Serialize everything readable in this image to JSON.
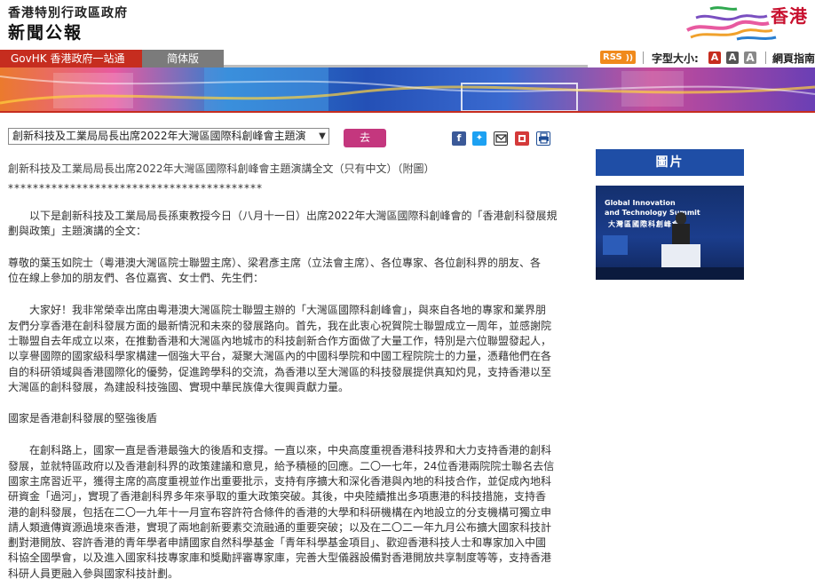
{
  "header": {
    "gov_name": "香港特別行政區政府",
    "site_name": "新聞公報",
    "brand_text": "香港"
  },
  "nav": {
    "govhk_label": "GovHK 香港政府一站通",
    "simplified_label": "简体版",
    "rss_label": "RSS",
    "font_size_label": "字型大小:",
    "font_btn_small": "A",
    "font_btn_medium": "A",
    "font_btn_large": "A",
    "sitemap_label": "網頁指南"
  },
  "selector": {
    "selected": "創新科技及工業局局長出席2022年大灣區國際科創峰會主題演",
    "go_label": "去"
  },
  "share": [
    "facebook-icon",
    "twitter-icon",
    "email-icon",
    "bookmark-icon",
    "print-icon"
  ],
  "sidebar": {
    "photo_heading": "圖片",
    "photo_title_1": "Global Innovation",
    "photo_title_2": "and Technology Summit",
    "photo_title_3": "大灣區國際科創峰會"
  },
  "article": {
    "title": "創新科技及工業局局長出席2022年大灣區國際科創峰會主題演講全文（只有中文）（附圖）",
    "stars": "*****************************************",
    "lines": [
      "　　以下是創新科技及工業局局長孫東教授今日（八月十一日）出席2022年大灣區國際科創峰會的「香港創科發展規",
      "劃與政策」主題演講的全文：",
      "",
      "尊敬的葉玉如院士（粵港澳大灣區院士聯盟主席）、梁君彥主席（立法會主席）、各位專家、各位創科界的朋友、各",
      "位在線上參加的朋友們、各位嘉賓、女士們、先生們：",
      "",
      "　　大家好！我非常榮幸出席由粵港澳大灣區院士聯盟主辦的「大灣區國際科創峰會」，與來自各地的專家和業界朋",
      "友們分享香港在創科發展方面的最新情況和未來的發展路向。首先，我在此衷心祝賀院士聯盟成立一周年，並感謝院",
      "士聯盟自去年成立以來，在推動香港和大灣區內地城市的科技創新合作方面做了大量工作，特別是六位聯盟發起人，",
      "以享譽國際的國家級科學家構建一個強大平台，凝聚大灣區內的中國科學院和中國工程院院士的力量，憑藉他們在各",
      "自的科研領域與香港國際化的優勢，促進跨學科的交流，為香港以至大灣區的科技發展提供真知灼見，支持香港以至",
      "大灣區的創科發展，為建設科技強國、實現中華民族偉大復興貢獻力量。",
      "",
      "國家是香港創科發展的堅強後盾",
      "",
      "　　在創科路上，國家一直是香港最強大的後盾和支撐。一直以來，中央高度重視香港科技界和大力支持香港的創科",
      "發展，並就特區政府以及香港創科界的政策建議和意見，給予積極的回應。二〇一七年，24位香港兩院院士聯名去信",
      "國家主席習近平，獲得主席的高度重視並作出重要批示，支持有序擴大和深化香港與內地的科技合作，並促成內地科",
      "研資金「過河」，實現了香港創科界多年來爭取的重大政策突破。其後，中央陸續推出多項惠港的科技措施，支持香",
      "港的創科發展，包括在二〇一九年十一月宣布容許符合條件的香港的大學和科研機構在內地設立的分支機構可獨立申",
      "請人類遺傳資源過境來香港，實現了兩地創新要素交流融通的重要突破；以及在二〇二一年九月公布擴大國家科技計",
      "劃對港開放、容許香港的青年學者申請國家自然科學基金「青年科學基金項目」、歡迎香港科技人士和專家加入中國",
      "科協全國學會，以及進入國家科技專家庫和獎勵評審專家庫，完善大型儀器設備對香港開放共享制度等等，支持香港",
      "科研人員更融入參與國家科技計劃。"
    ]
  },
  "colors": {
    "accent_red": "#c62d1f",
    "simplified_gray": "#7b7b7b",
    "go_button": "#c4377e",
    "photo_heading": "#1f4ea6",
    "rss_orange": "#f08a1c"
  }
}
